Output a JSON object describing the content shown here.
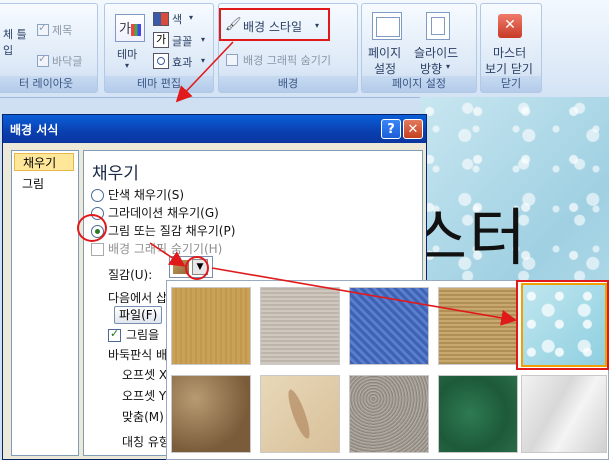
{
  "ribbon": {
    "groups": {
      "layout": {
        "label": "터 레이아웃",
        "items": [
          "제목",
          "바닥글"
        ],
        "left_fragments": [
          "체 틀",
          "입"
        ]
      },
      "theme": {
        "label": "테마 편집",
        "theme_button": "테마",
        "colors": "색",
        "fonts": "글꼴",
        "effects": "효과"
      },
      "background": {
        "label": "배경",
        "style_button": "배경 스타일",
        "hide_graphics": "배경 그래픽 숨기기"
      },
      "page_setup": {
        "label": "페이지 설정",
        "page_setup_line1": "페이지",
        "page_setup_line2": "설정",
        "orientation_line1": "슬라이드",
        "orientation_line2": "방향"
      },
      "close": {
        "label": "닫기",
        "close_line1": "마스터",
        "close_line2": "보기 닫기"
      }
    }
  },
  "slide": {
    "title_fragment": "스터"
  },
  "dialog": {
    "title": "배경 서식",
    "help_glyph": "?",
    "close_glyph": "✕",
    "nav": [
      "채우기",
      "그림"
    ],
    "panel": {
      "title": "채우기",
      "options": [
        "단색 채우기(S)",
        "그라데이션 채우기(G)",
        "그림 또는 질감 채우기(P)"
      ],
      "hide_background": "배경 그래픽 숨기기(H)",
      "texture_label": "질감(U):",
      "insert_from": "다음에서 삽",
      "file_button": "파일(F)",
      "picture_checkbox": "그림을",
      "tile_label": "바둑판식 배",
      "offset_x": "오프셋 X",
      "offset_y": "오프셋 Y",
      "align": "맞춤(M)",
      "mirror": "대칭 유형"
    }
  },
  "gallery": {
    "textures": [
      "papyrus",
      "canvas",
      "denim",
      "woven-mat",
      "water-droplets",
      "brown-paper",
      "fish-fossil",
      "sand",
      "green-marble",
      "white-marble"
    ]
  },
  "colors": {
    "highlight_red": "#e0191b",
    "selected_nav": "#ffe79a",
    "selected_texture_border": "#f0a000"
  }
}
